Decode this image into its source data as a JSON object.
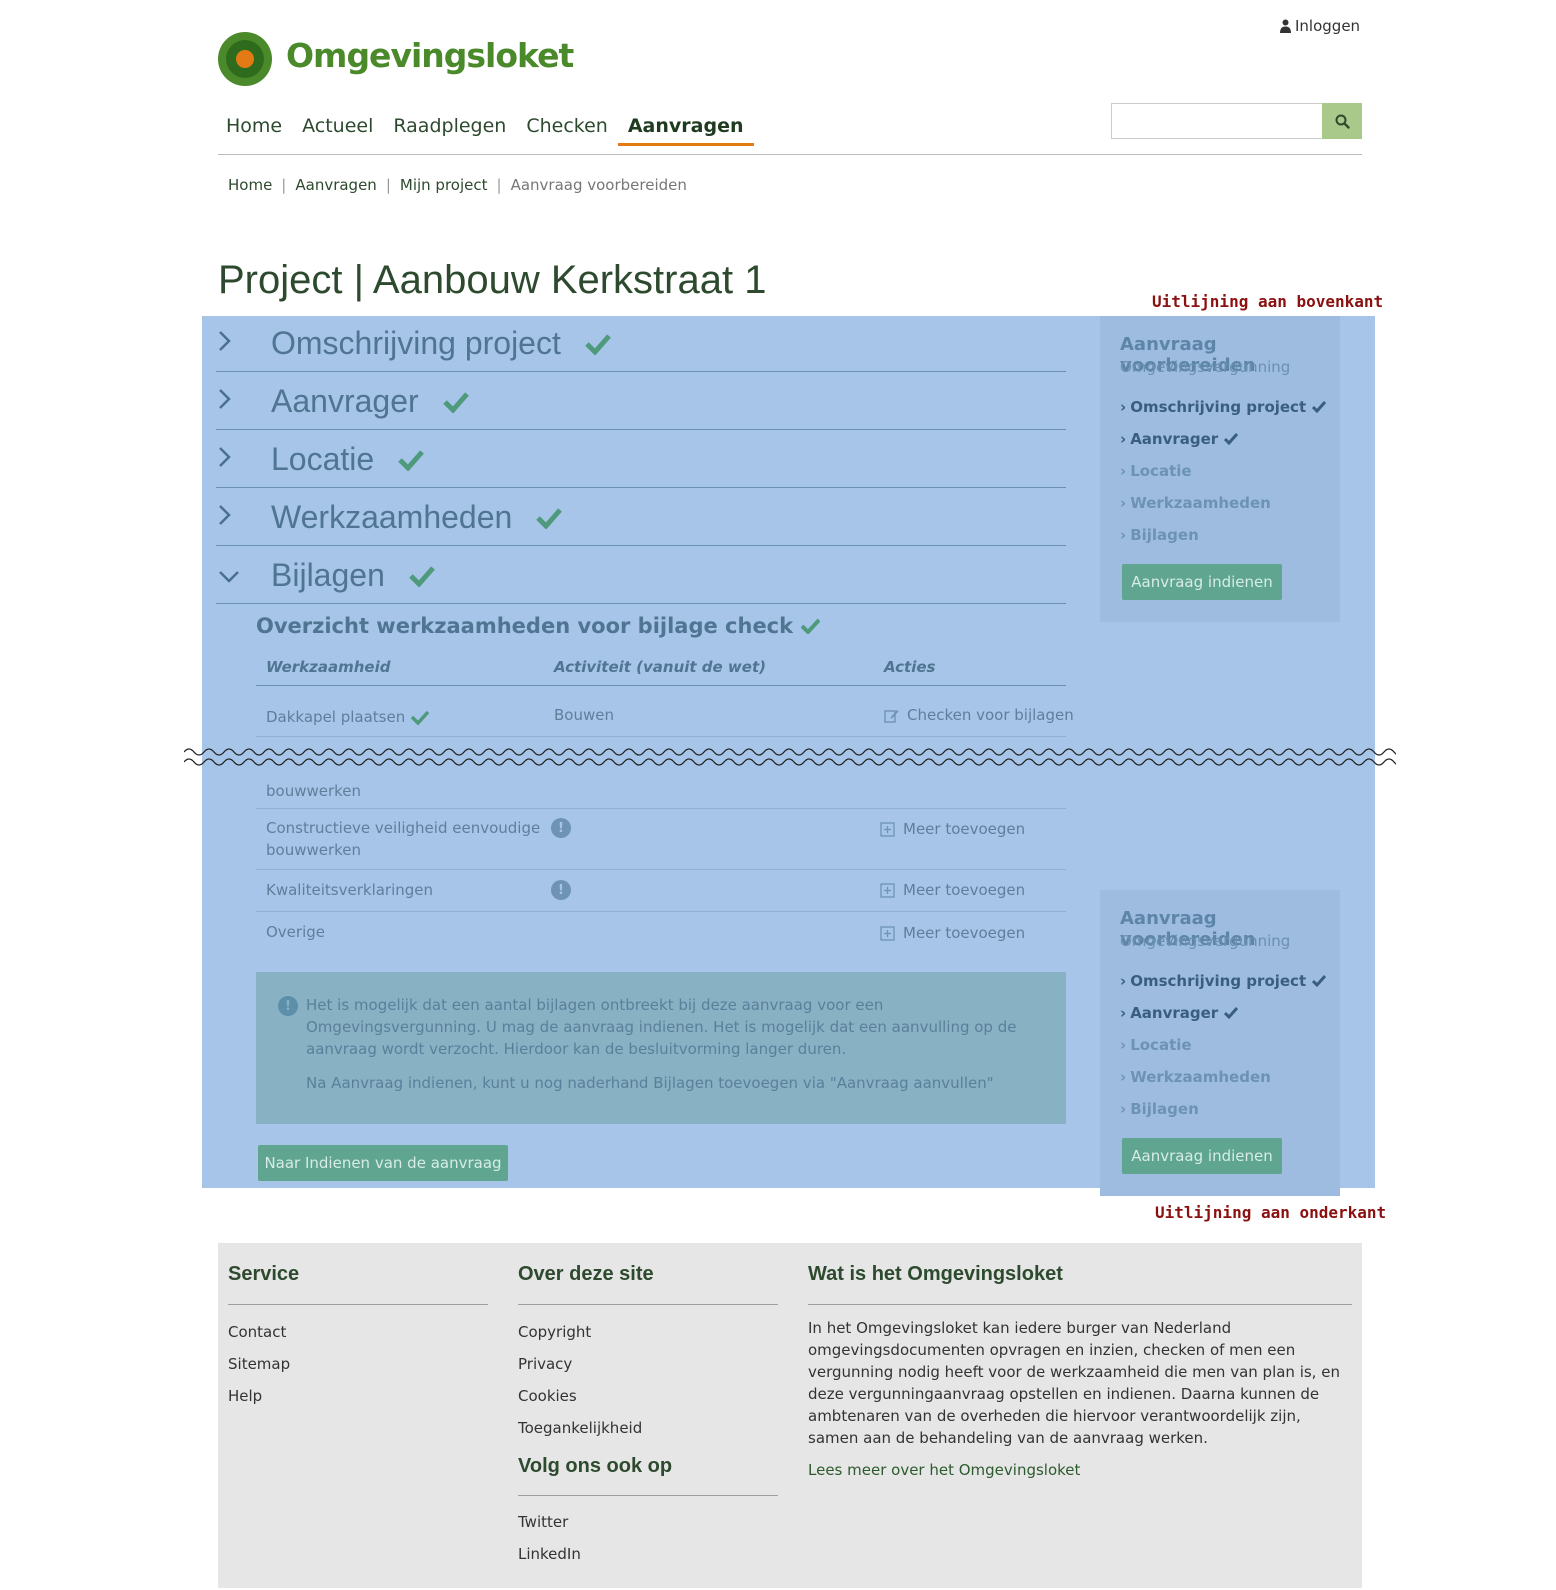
{
  "header": {
    "logo_text": "Omgevingsloket",
    "login_label": "Inloggen",
    "nav": [
      "Home",
      "Actueel",
      "Raadplegen",
      "Checken",
      "Aanvragen"
    ],
    "search_placeholder": ""
  },
  "breadcrumb": [
    "Home",
    "Aanvragen",
    "Mijn project",
    "Aanvraag voorbereiden"
  ],
  "page_title": "Project | Aanbouw Kerkstraat 1",
  "annotations": {
    "top": "Uitlijning aan bovenkant",
    "bottom": "Uitlijning aan onderkant"
  },
  "accordion": [
    {
      "label": "Omschrijving project"
    },
    {
      "label": "Aanvrager"
    },
    {
      "label": "Locatie"
    },
    {
      "label": "Werkzaamheden"
    },
    {
      "label": "Bijlagen"
    }
  ],
  "bijlagen": {
    "subtitle": "Overzicht werkzaamheden voor bijlage check",
    "columns": [
      "Werkzaamheid",
      "Activiteit (vanuit de wet)",
      "Acties"
    ],
    "rows": [
      {
        "work": "Dakkapel plaatsen",
        "activity": "Bouwen",
        "action": "Checken voor bijlagen"
      },
      {
        "work_tail": "bouwwerken"
      },
      {
        "work": "Constructieve veiligheid eenvoudige bouwwerken",
        "action": "Meer toevoegen"
      },
      {
        "work": "Kwaliteitsverklaringen",
        "action": "Meer toevoegen"
      },
      {
        "work": "Overige",
        "action": "Meer toevoegen"
      }
    ],
    "alert_p1": "Het is mogelijk dat een aantal bijlagen ontbreekt bij deze aanvraag voor een Omgevingsvergunning. U mag de aanvraag indienen. Het is mogelijk dat een aanvulling op de aanvraag wordt verzocht. Hierdoor kan de besluitvorming langer duren.",
    "alert_p2": "Na Aanvraag indienen, kunt u nog naderhand Bijlagen toevoegen via \"Aanvraag aanvullen\"",
    "next_button": "Naar Indienen van de aanvraag"
  },
  "side_panel": {
    "title": "Aanvraag voorbereiden",
    "subtitle": "Omgevingsvergunning",
    "items": [
      "Omschrijving project",
      "Aanvrager",
      "Locatie",
      "Werkzaamheden",
      "Bijlagen"
    ],
    "button": "Aanvraag indienen"
  },
  "footer": {
    "service": {
      "title": "Service",
      "links": [
        "Contact",
        "Sitemap",
        "Help"
      ]
    },
    "over": {
      "title": "Over deze site",
      "links": [
        "Copyright",
        "Privacy",
        "Cookies",
        "Toegankelijkheid"
      ]
    },
    "volg": {
      "title": "Volg ons ook op",
      "links": [
        "Twitter",
        "LinkedIn"
      ]
    },
    "wat": {
      "title": "Wat is het Omgevingsloket",
      "text": "In het Omgevingsloket kan iedere burger van Nederland omgevingsdocumenten opvragen en inzien, checken of men een vergunning nodig heeft voor de werkzaamheid die men van plan is, en deze vergunningaanvraag opstellen en indienen. Daarna kunnen de ambtenaren van de overheden die hiervoor verantwoordelijk zijn, samen aan de behandeling van de aanvraag werken.",
      "more": "Lees meer over het Omgevingsloket"
    }
  },
  "colors": {
    "brand_green": "#4b8a2a",
    "accent_orange": "#e37a13",
    "highlight_blue": "#a7c5e8",
    "button_green": "#5fa58f",
    "annotation_red": "#8b1010"
  }
}
